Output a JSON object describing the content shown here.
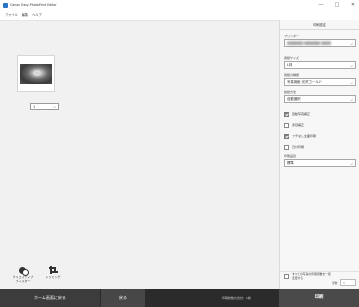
{
  "window": {
    "title": "Canon Easy-PhotoPrint Editor",
    "controls": {
      "minimize": "—",
      "maximize": "□",
      "close": "✕"
    }
  },
  "menu": [
    "ファイル",
    "編集",
    "ヘルプ"
  ],
  "preview": {
    "copies": "1"
  },
  "tools": {
    "creative_filter": "クリエイティブ\nフィルター",
    "trimming": "トリミング"
  },
  "panel": {
    "title": "印刷設定",
    "printer_label": "プリンター",
    "printer_value": "■■■■■ ■■■■■ ■■■",
    "paper_size_label": "用紙サイズ",
    "paper_size_value": "L判",
    "media_label": "用紙の種類",
    "media_value": "写真用紙 光沢ゴールド",
    "print_method_label": "給紙方法",
    "print_method_value": "自動選択",
    "options": [
      {
        "label": "自動写真補正",
        "checked": true
      },
      {
        "label": "赤目補正",
        "checked": false
      },
      {
        "label": "フチなし全面印刷",
        "checked": true
      },
      {
        "label": "日付印刷",
        "checked": false
      }
    ],
    "quality_label": "印刷品質",
    "quality_value": "標準",
    "copies_all_label": "すべての写真の印刷部数を一括変更する",
    "copies_all_prefix": "部数",
    "copies_all_value": "1"
  },
  "footer": {
    "home": "ホーム画面に戻る",
    "back": "戻る",
    "total": "印刷枚数の合計：1枚",
    "print": "印刷"
  },
  "colors": {
    "accent_ring": "#d6233a",
    "footer_bg": "#2b2b2b"
  }
}
